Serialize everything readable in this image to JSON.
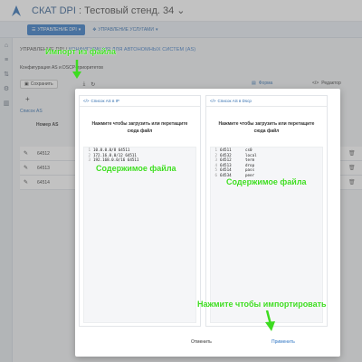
{
  "header": {
    "app_name": "СКАТ DPI",
    "separator": ":",
    "stand_name": "Тестовый стенд. 34",
    "stand_chevron": "⌄"
  },
  "navbar": {
    "management_dpi": "УПРАВЛЕНИЕ DPI",
    "management_services": "УПРАВЛЕНИЕ УСЛУГАМИ"
  },
  "page": {
    "breadcrumb_parent": "УПРАВЛЕНИЕ DPI",
    "breadcrumb_current": "КОНФИГУРАЦИЯ ДЛЯ АВТОНОМНЫХ СИСТЕМ (AS)",
    "config_label": "Конфигурация AS и DSCP-приоритетов",
    "save_label": "Сохранить",
    "form_tab": "Форма",
    "editor_tab": "Редактор",
    "list_tab": "Список AS",
    "column_header": "Номер AS",
    "rows": [
      "64512",
      "64513",
      "64514"
    ]
  },
  "modal": {
    "left_panel": {
      "title": "Список AS в IP",
      "drop_text": "Нажмите чтобы загрузить или перетащите сюда файл",
      "lines": [
        {
          "n": "1",
          "a": "10.0.0.0/8",
          "b": "64511"
        },
        {
          "n": "2",
          "a": "172.16.0.0/12",
          "b": "64511"
        },
        {
          "n": "3",
          "a": "192.168.0.0/16",
          "b": "64511"
        }
      ]
    },
    "right_panel": {
      "title": "Список AS в Dscp",
      "drop_text": "Нажмите чтобы загрузить или перетащите сюда файл",
      "lines": [
        {
          "n": "1",
          "a": "64511",
          "b": "cs0"
        },
        {
          "n": "2",
          "a": "64532",
          "b": "local"
        },
        {
          "n": "3",
          "a": "64512",
          "b": "term"
        },
        {
          "n": "4",
          "a": "64513",
          "b": "drop"
        },
        {
          "n": "5",
          "a": "64514",
          "b": "pass"
        },
        {
          "n": "6",
          "a": "64534",
          "b": "peer"
        }
      ]
    },
    "cancel_label": "Отменить",
    "apply_label": "Применить"
  },
  "annotations": {
    "import_from_file": "Импорт из файла",
    "file_contents_left": "Содержимое файла",
    "file_contents_right": "Содержимое файла",
    "click_to_import": "Нажмите чтобы импортировать",
    "annotation_color": "#3ddc20"
  },
  "colors": {
    "accent": "#2f75c4",
    "link": "#2f6cae"
  }
}
